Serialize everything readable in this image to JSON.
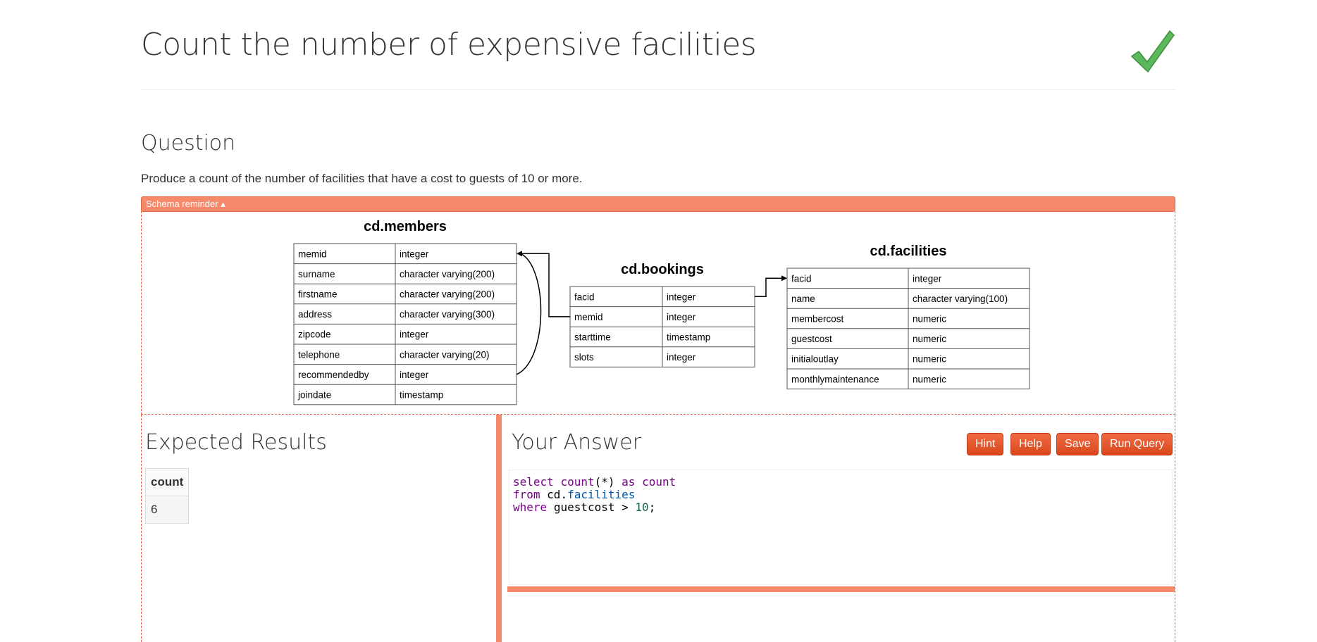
{
  "page": {
    "title": "Count the number of expensive facilities",
    "status_icon": "check-icon",
    "accent_color": "#f7896b"
  },
  "question": {
    "heading": "Question",
    "text": "Produce a count of the number of facilities that have a cost to guests of 10 or more."
  },
  "schema": {
    "toggle_label": "Schema reminder ▴",
    "tables": [
      {
        "name": "cd.members",
        "columns": [
          [
            "memid",
            "integer"
          ],
          [
            "surname",
            "character varying(200)"
          ],
          [
            "firstname",
            "character varying(200)"
          ],
          [
            "address",
            "character varying(300)"
          ],
          [
            "zipcode",
            "integer"
          ],
          [
            "telephone",
            "character varying(20)"
          ],
          [
            "recommendedby",
            "integer"
          ],
          [
            "joindate",
            "timestamp"
          ]
        ]
      },
      {
        "name": "cd.bookings",
        "columns": [
          [
            "facid",
            "integer"
          ],
          [
            "memid",
            "integer"
          ],
          [
            "starttime",
            "timestamp"
          ],
          [
            "slots",
            "integer"
          ]
        ]
      },
      {
        "name": "cd.facilities",
        "columns": [
          [
            "facid",
            "integer"
          ],
          [
            "name",
            "character varying(100)"
          ],
          [
            "membercost",
            "numeric"
          ],
          [
            "guestcost",
            "numeric"
          ],
          [
            "initialoutlay",
            "numeric"
          ],
          [
            "monthlymaintenance",
            "numeric"
          ]
        ]
      }
    ]
  },
  "expected": {
    "heading": "Expected Results",
    "columns": [
      "count"
    ],
    "rows": [
      [
        "6"
      ]
    ]
  },
  "answer": {
    "heading": "Your Answer",
    "buttons": {
      "hint": "Hint",
      "help": "Help",
      "save": "Save",
      "run": "Run Query"
    },
    "code": {
      "line1": [
        "select",
        "count",
        "(*)",
        "as",
        "count"
      ],
      "line2": [
        "from",
        "cd.",
        "facilities"
      ],
      "line3": [
        "where",
        "guestcost >",
        "10",
        ";"
      ]
    }
  }
}
